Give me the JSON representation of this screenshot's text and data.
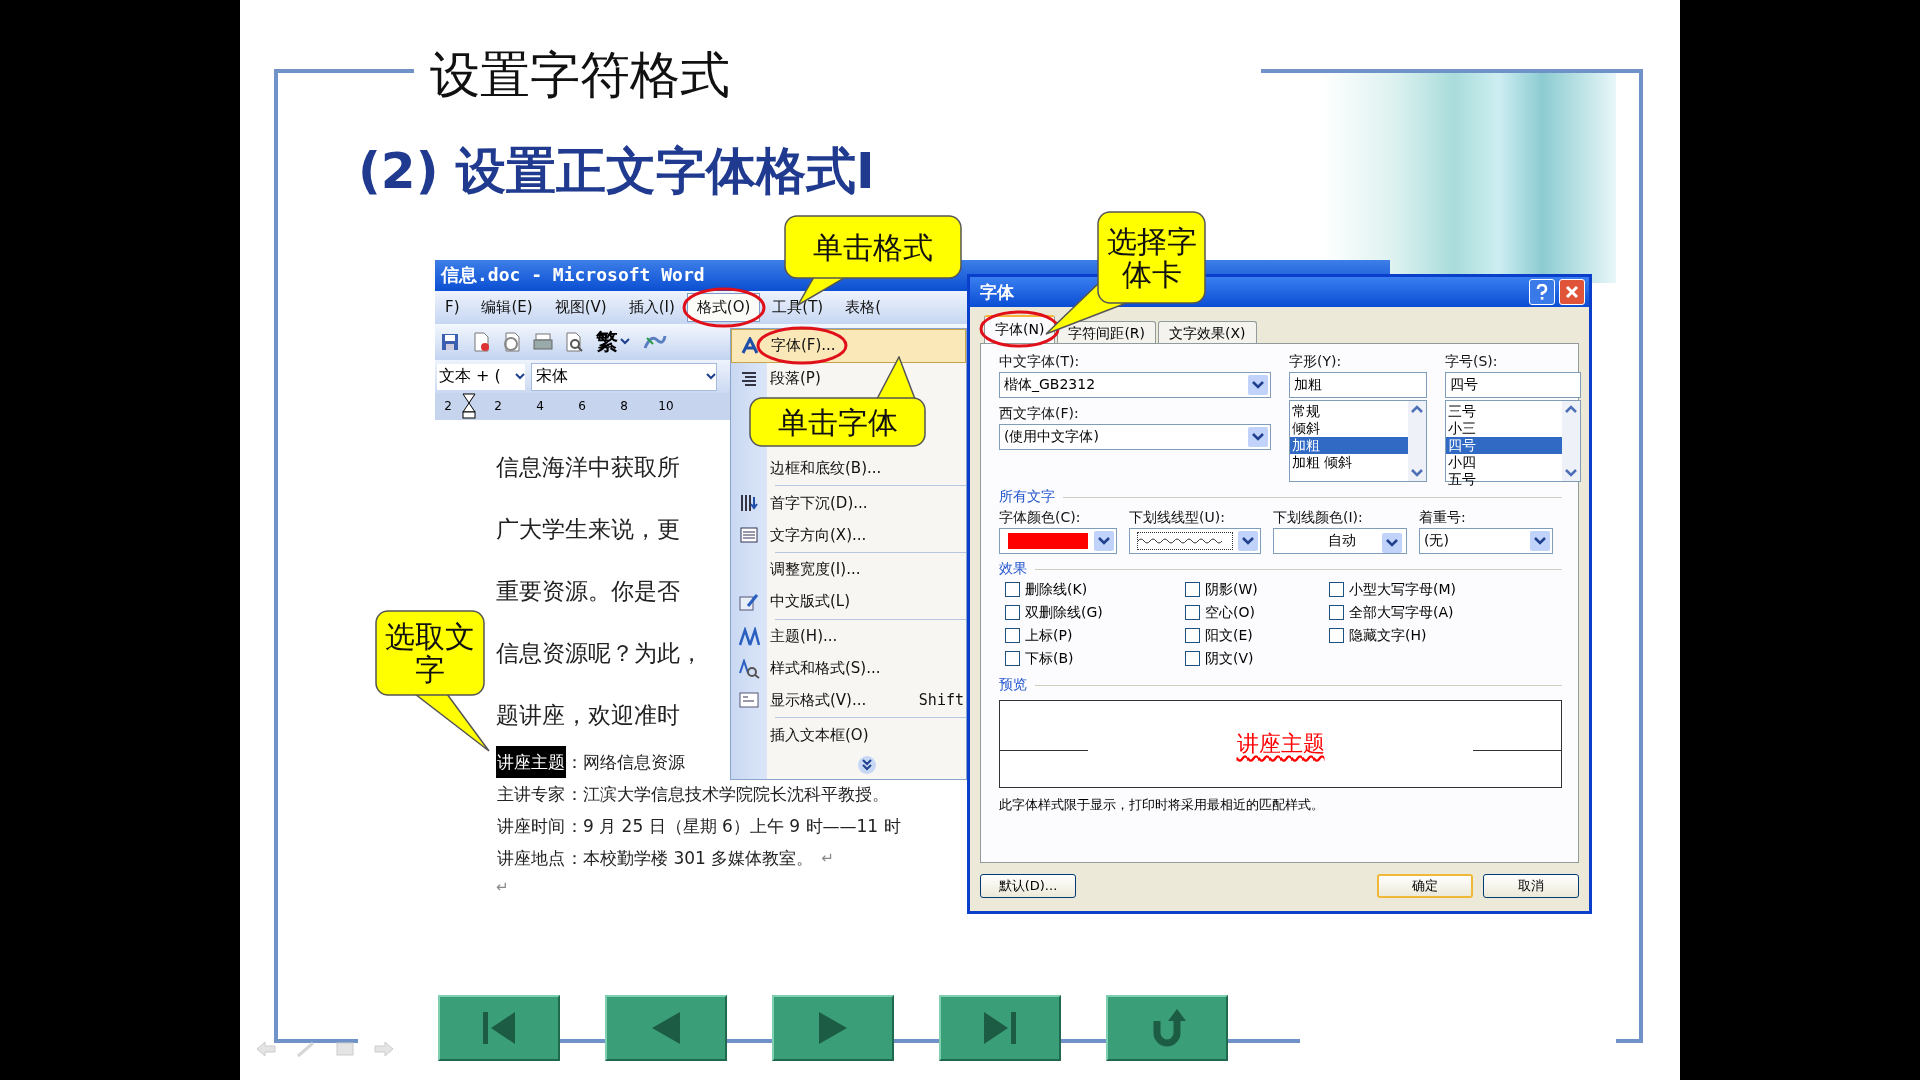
{
  "slide": {
    "title": "设置字符格式",
    "subtitle": "(2) 设置正文字体格式I"
  },
  "word": {
    "title": "信息.doc - Microsoft Word",
    "menu": [
      {
        "label": "F)",
        "selected": false
      },
      {
        "label": "编辑(E)",
        "selected": false
      },
      {
        "label": "视图(V)",
        "selected": false
      },
      {
        "label": "插入(I)",
        "selected": false
      },
      {
        "label": "格式(O)",
        "selected": true
      },
      {
        "label": "工具(T)",
        "selected": false
      },
      {
        "label": "表格(",
        "selected": false
      }
    ],
    "toolbar": {
      "convert_label": "繁"
    },
    "style_box": "文本 + (",
    "font_box": "宋体",
    "ruler": [
      "2",
      "2",
      "4",
      "6",
      "8",
      "10"
    ],
    "paragraphs": [
      "信息海洋中获取所",
      "广大学生来说，更",
      "重要资源。你是否",
      "信息资源呢？为此，",
      "题讲座，欢迎准时"
    ],
    "details": [
      {
        "label": "讲座主题",
        "text": "：网络信息资源",
        "selected": true
      },
      {
        "label": "主讲专家",
        "text": "：江滨大学信息技术学院院长沈科平教授。",
        "selected": false
      },
      {
        "label": "讲座时间",
        "text": "：9 月 25 日（星期 6）上午 9 时——11 时",
        "selected": false
      },
      {
        "label": "讲座地点",
        "text": "：本校勤学楼 301 多媒体教室。",
        "selected": false,
        "mark": "↵"
      }
    ],
    "empty_line_mark": "↵",
    "format_menu": [
      {
        "kind": "item",
        "label": "字体(F)...",
        "selected": true,
        "separator_before": false
      },
      {
        "kind": "item",
        "label": "段落(P)",
        "selected": false,
        "separator_before": false
      },
      {
        "kind": "covered"
      },
      {
        "kind": "item",
        "label": "边框和底纹(B)...",
        "selected": false,
        "separator_before": false
      },
      {
        "kind": "item",
        "label": "首字下沉(D)...",
        "selected": false,
        "separator_before": true
      },
      {
        "kind": "item",
        "label": "文字方向(X)...",
        "selected": false,
        "separator_before": false
      },
      {
        "kind": "item",
        "label": "调整宽度(I)...",
        "selected": false,
        "separator_before": true
      },
      {
        "kind": "item",
        "label": "中文版式(L)",
        "selected": false,
        "separator_before": false
      },
      {
        "kind": "item",
        "label": "主题(H)...",
        "selected": false,
        "separator_before": true
      },
      {
        "kind": "item",
        "label": "样式和格式(S)...",
        "selected": false,
        "separator_before": false
      },
      {
        "kind": "item",
        "label": "显示格式(V)...",
        "selected": false,
        "separator_before": false,
        "shortcut": "Shift"
      },
      {
        "kind": "item",
        "label": "插入文本框(O)",
        "selected": false,
        "separator_before": true
      },
      {
        "kind": "expand"
      }
    ]
  },
  "dialog": {
    "title": "字体",
    "tabs": [
      {
        "label": "字体(N)",
        "selected": true
      },
      {
        "label": "字符间距(R)",
        "selected": false
      },
      {
        "label": "文字效果(X)",
        "selected": false
      }
    ],
    "chinese_font": {
      "label": "中文字体(T):",
      "value": "楷体_GB2312"
    },
    "western_font": {
      "label": "西文字体(F):",
      "value": "(使用中文字体)"
    },
    "font_style": {
      "label": "字形(Y):",
      "value": "加粗",
      "options": [
        {
          "label": "常规",
          "selected": false
        },
        {
          "label": "倾斜",
          "selected": false
        },
        {
          "label": "加粗",
          "selected": true
        },
        {
          "label": "加粗 倾斜",
          "selected": false
        }
      ]
    },
    "font_size": {
      "label": "字号(S):",
      "value": "四号",
      "options": [
        {
          "label": "三号",
          "selected": false
        },
        {
          "label": "小三",
          "selected": false
        },
        {
          "label": "四号",
          "selected": true
        },
        {
          "label": "小四",
          "selected": false
        },
        {
          "label": "五号",
          "selected": false
        }
      ]
    },
    "all_text": {
      "heading": "所有文字",
      "font_color": {
        "label": "字体颜色(C):",
        "color": "#ff0000"
      },
      "underline_style": {
        "label": "下划线线型(U):",
        "kind": "wavy"
      },
      "underline_color": {
        "label": "下划线颜色(I):",
        "value": "自动"
      },
      "emphasis": {
        "label": "着重号:",
        "value": "(无)"
      }
    },
    "effects": {
      "heading": "效果",
      "columns": [
        [
          {
            "label": "删除线(K)",
            "checked": false
          },
          {
            "label": "双删除线(G)",
            "checked": false
          },
          {
            "label": "上标(P)",
            "checked": false
          },
          {
            "label": "下标(B)",
            "checked": false
          }
        ],
        [
          {
            "label": "阴影(W)",
            "checked": false
          },
          {
            "label": "空心(O)",
            "checked": false
          },
          {
            "label": "阳文(E)",
            "checked": false
          },
          {
            "label": "阴文(V)",
            "checked": false
          }
        ],
        [
          {
            "label": "小型大写字母(M)",
            "checked": false
          },
          {
            "label": "全部大写字母(A)",
            "checked": false
          },
          {
            "label": "隐藏文字(H)",
            "checked": false
          }
        ]
      ]
    },
    "preview": {
      "heading": "预览",
      "sample": "讲座主题",
      "note": "此字体样式限于显示，打印时将采用最相近的匹配样式。"
    },
    "buttons": [
      {
        "label": "默认(D)...",
        "default": false
      },
      {
        "label": "确定",
        "default": true
      },
      {
        "label": "取消",
        "default": false
      }
    ]
  },
  "callouts": [
    {
      "text": "单击格式"
    },
    {
      "text": "选择字体卡"
    },
    {
      "text": "单击字体"
    },
    {
      "text": "选取文字"
    }
  ],
  "nav_buttons": [
    {
      "kind": "first"
    },
    {
      "kind": "previous"
    },
    {
      "kind": "next"
    },
    {
      "kind": "last"
    },
    {
      "kind": "return"
    }
  ]
}
